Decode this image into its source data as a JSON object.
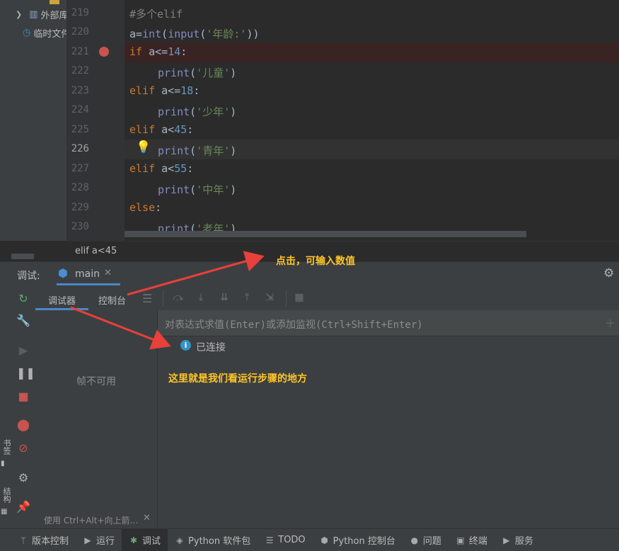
{
  "tree": {
    "items": [
      {
        "label": "外部库",
        "icon": "library-icon"
      },
      {
        "label": "临时文件和控制台",
        "icon": "scratch-icon"
      }
    ]
  },
  "editor": {
    "lines": [
      {
        "num": "219"
      },
      {
        "num": "220"
      },
      {
        "num": "221"
      },
      {
        "num": "222"
      },
      {
        "num": "223"
      },
      {
        "num": "224"
      },
      {
        "num": "225"
      },
      {
        "num": "226"
      },
      {
        "num": "227"
      },
      {
        "num": "228"
      },
      {
        "num": "229"
      },
      {
        "num": "230"
      }
    ],
    "code": {
      "l219": "#多个elif",
      "l220_a": "a=",
      "l220_int": "int",
      "l220_p1": "(",
      "l220_input": "input",
      "l220_p2": "(",
      "l220_str": "'年龄:'",
      "l220_p3": "))",
      "l221_kw": "if",
      "l221_rest": " a<=",
      "l221_num": "14",
      "l221_colon": ":",
      "print": "print",
      "l222_str": "'儿童'",
      "elif": "elif",
      "l223_rest": " a<=",
      "l223_num": "18",
      "l224_str": "'少年'",
      "l225_rest": " a<",
      "l225_num": "45",
      "l226_str": "'青年'",
      "l227_rest": " a<",
      "l227_num": "55",
      "l228_str": "'中年'",
      "else": "else",
      "l230_str": "'老年'",
      "lp": "(",
      "rp": ")",
      "colon": ":"
    },
    "breadcrumb": "elif a<45"
  },
  "debug": {
    "label": "调试:",
    "session_tab": "main",
    "tabs": {
      "debugger": "调试器",
      "console": "控制台"
    },
    "watch_placeholder": "对表达式求值(Enter)或添加监视(Ctrl+Shift+Enter)",
    "frames_unavailable": "帧不可用",
    "frames_hint": "使用 Ctrl+Alt+向上箭头和 Ctrl+Alt+向下箭头",
    "connected": "已连接"
  },
  "side_labels": {
    "bookmarks": "书签",
    "structure": "结构"
  },
  "annotations": {
    "click_hint": "点击，可输入数值",
    "steps_hint": "这里就是我们看运行步骤的地方"
  },
  "statusbar": [
    {
      "label": "版本控制",
      "icon": "vcs-icon"
    },
    {
      "label": "运行",
      "icon": "run-icon"
    },
    {
      "label": "调试",
      "icon": "debug-icon"
    },
    {
      "label": "Python 软件包",
      "icon": "packages-icon"
    },
    {
      "label": "TODO",
      "icon": "todo-icon"
    },
    {
      "label": "Python 控制台",
      "icon": "python-console-icon"
    },
    {
      "label": "问题",
      "icon": "problems-icon"
    },
    {
      "label": "终端",
      "icon": "terminal-icon"
    },
    {
      "label": "服务",
      "icon": "services-icon"
    }
  ],
  "colors": {
    "accent_annotation": "#ffc527",
    "breakpoint": "#c75450",
    "arrow": "#e8403a"
  }
}
